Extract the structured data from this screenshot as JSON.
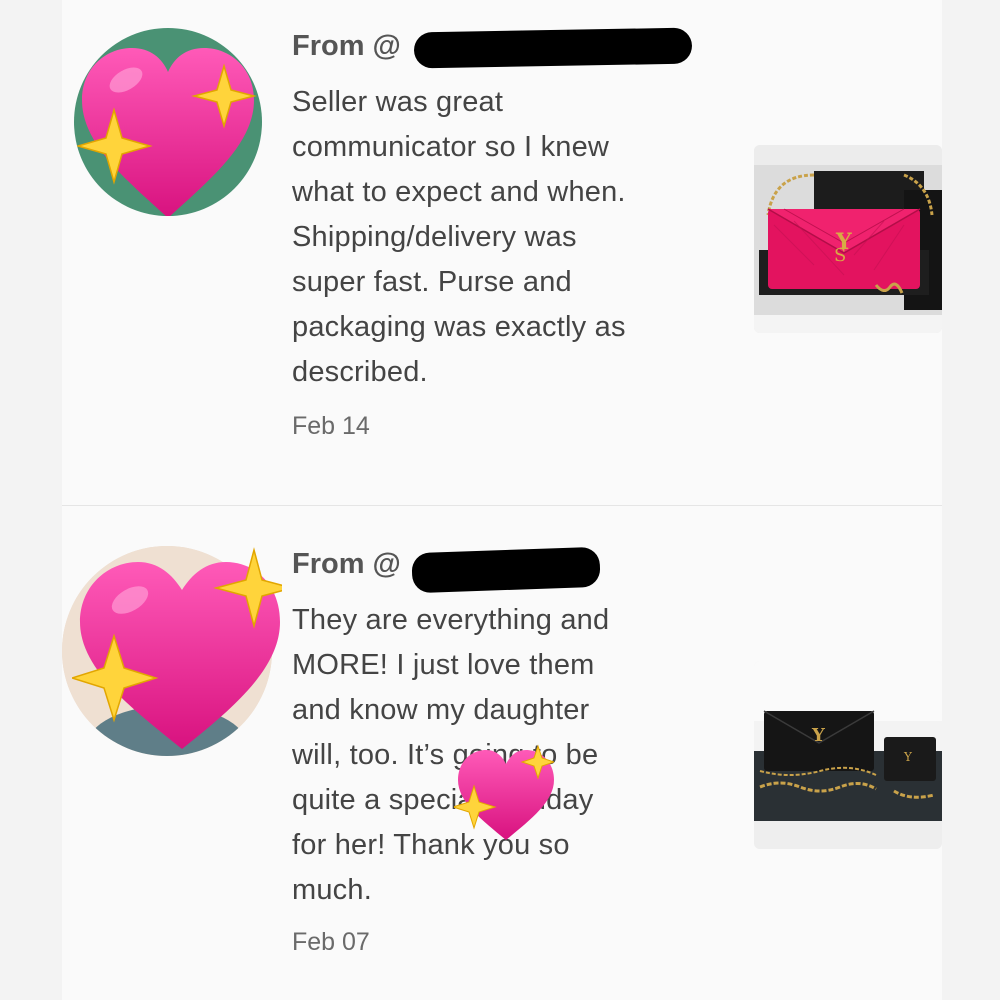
{
  "reviews": [
    {
      "from_prefix": "From @",
      "body": "Seller was great communicator so I knew what to expect and when. Shipping/delivery was super fast. Purse and packaging was exactly as described.",
      "body_lines": [
        "Seller was great",
        "communicator so I knew",
        "what to expect and when.",
        "Shipping/delivery was",
        "super fast. Purse and",
        "packaging was exactly as",
        "described."
      ],
      "date": "Feb 14",
      "avatar_icon": "sparkling-heart-icon",
      "photo_icon": "pink-wallet-on-chain-photo"
    },
    {
      "from_prefix": "From @",
      "body": "They are everything and MORE! I just love them and know my daughter will, too. It’s going to be quite a special birthday for her! Thank you so much.",
      "body_lines": [
        "They are everything and",
        "MORE! I just love them",
        "and know my daughter",
        "will, too. It’s going to be",
        "quite a special birthday",
        "for her! Thank you so",
        "much."
      ],
      "date": "Feb 07",
      "avatar_icon": "sparkling-heart-icon",
      "photo_icon": "black-wallet-and-card-case-photo"
    }
  ],
  "colors": {
    "heart_pink": "#e8208f",
    "sparkle_yellow": "#ffd43b",
    "avatar_green": "#4a9274",
    "text": "#444444",
    "date": "#6a6a6a",
    "redaction": "#000000"
  }
}
